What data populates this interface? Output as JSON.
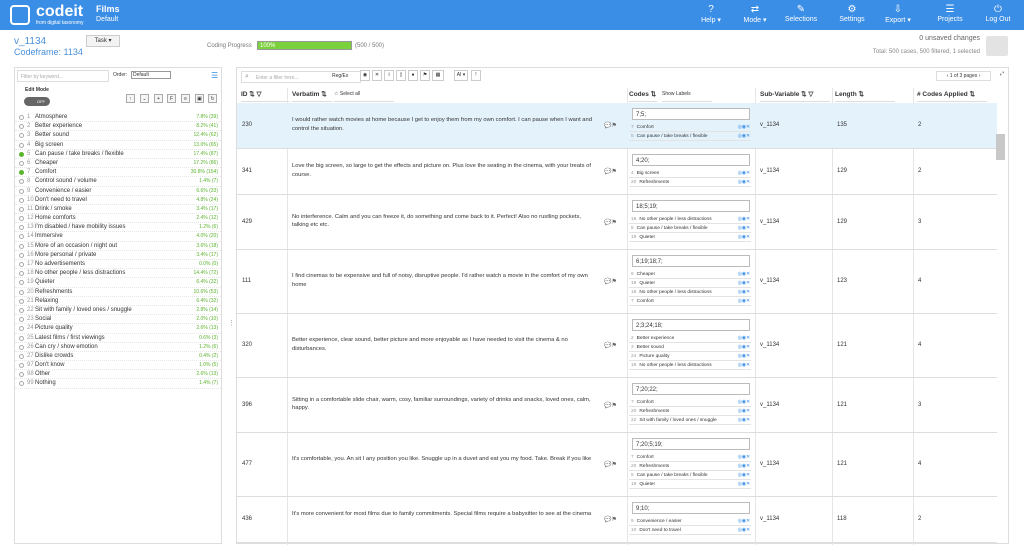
{
  "app": {
    "logo": "codeit",
    "tagline": "from digital taxonomy",
    "project": "Films",
    "project_sub": "Default"
  },
  "nav": [
    {
      "label": "Help ▾",
      "icon": "?"
    },
    {
      "label": "Mode ▾",
      "icon": "⇄"
    },
    {
      "label": "Selections",
      "icon": "✎"
    },
    {
      "label": "Settings",
      "icon": "⚙"
    },
    {
      "label": "Export ▾",
      "icon": "⇩"
    },
    {
      "label": "Projects",
      "icon": "☰"
    },
    {
      "label": "Log Out",
      "icon": "⏻"
    }
  ],
  "header": {
    "variable": "v_1134",
    "codeframe": "Codeframe: 1134",
    "task": "Task ▾",
    "progress_label": "Coding Progress",
    "progress_value": 100,
    "progress_text": "100%",
    "progress_count": "(500 / 500)",
    "unsaved": "0 unsaved changes",
    "total": "Total: 500 cases, 500 filtered, 1 selected"
  },
  "left": {
    "search_placeholder": "Filter by keyword...",
    "order_label": "Order:",
    "order_value": "Default",
    "edit_mode": "Edit Mode",
    "toggle": "OFF",
    "codes": [
      {
        "num": "1",
        "label": "Atmosphere",
        "pct": "7.8% (39)",
        "on": false
      },
      {
        "num": "2",
        "label": "Better experience",
        "pct": "8.2% (41)",
        "on": false
      },
      {
        "num": "3",
        "label": "Better sound",
        "pct": "12.4% (62)",
        "on": false
      },
      {
        "num": "4",
        "label": "Big screen",
        "pct": "13.0% (65)",
        "on": false
      },
      {
        "num": "5",
        "label": "Can pause / take breaks / flexible",
        "pct": "17.4% (87)",
        "on": true
      },
      {
        "num": "6",
        "label": "Cheaper",
        "pct": "17.2% (86)",
        "on": false
      },
      {
        "num": "7",
        "label": "Comfort",
        "pct": "30.8% (154)",
        "on": true
      },
      {
        "num": "8",
        "label": "Control sound / volume",
        "pct": "1.4% (7)",
        "on": false
      },
      {
        "num": "9",
        "label": "Convenience / easier",
        "pct": "6.6% (33)",
        "on": false
      },
      {
        "num": "10",
        "label": "Don't need to travel",
        "pct": "4.8% (24)",
        "on": false
      },
      {
        "num": "11",
        "label": "Drink / smoke",
        "pct": "3.4% (17)",
        "on": false
      },
      {
        "num": "12",
        "label": "Home comforts",
        "pct": "2.4% (12)",
        "on": false
      },
      {
        "num": "13",
        "label": "I'm disabled / have mobility issues",
        "pct": "1.2% (6)",
        "on": false
      },
      {
        "num": "14",
        "label": "Immersive",
        "pct": "4.0% (20)",
        "on": false
      },
      {
        "num": "15",
        "label": "More of an occasion / night out",
        "pct": "3.6% (18)",
        "on": false
      },
      {
        "num": "16",
        "label": "More personal / private",
        "pct": "3.4% (17)",
        "on": false
      },
      {
        "num": "17",
        "label": "No advertisements",
        "pct": "0.0% (0)",
        "on": false
      },
      {
        "num": "18",
        "label": "No other people / less distractions",
        "pct": "14.4% (72)",
        "on": false
      },
      {
        "num": "19",
        "label": "Quieter",
        "pct": "6.4% (32)",
        "on": false
      },
      {
        "num": "20",
        "label": "Refreshments",
        "pct": "10.6% (53)",
        "on": false
      },
      {
        "num": "21",
        "label": "Relaxing",
        "pct": "6.4% (32)",
        "on": false
      },
      {
        "num": "22",
        "label": "Sit with family / loved ones / snuggle",
        "pct": "2.8% (14)",
        "on": false
      },
      {
        "num": "23",
        "label": "Social",
        "pct": "2.0% (10)",
        "on": false
      },
      {
        "num": "24",
        "label": "Picture quality",
        "pct": "2.6% (13)",
        "on": false
      },
      {
        "num": "25",
        "label": "Latest films / first viewings",
        "pct": "0.6% (3)",
        "on": false
      },
      {
        "num": "26",
        "label": "Can cry / show emotion",
        "pct": "1.2% (6)",
        "on": false
      },
      {
        "num": "27",
        "label": "Dislike crowds",
        "pct": "0.4% (2)",
        "on": false
      },
      {
        "num": "97",
        "label": "Don't know",
        "pct": "1.0% (5)",
        "on": false
      },
      {
        "num": "98",
        "label": "Other",
        "pct": "2.6% (13)",
        "on": false
      },
      {
        "num": "99",
        "label": "Nothing",
        "pct": "1.4% (7)",
        "on": false
      }
    ]
  },
  "right": {
    "filter_placeholder": "Enter a filter here...",
    "regex": "Reg/Ex",
    "ai": "AI ▾",
    "pager": "‹ 1 of 3 pages ›",
    "headers": {
      "id": "ID ⇅ ▽",
      "verbatim": "Verbatim ⇅",
      "select_all": "☆ Select all",
      "codes": "Codes ⇅",
      "show_labels": "Show Labels",
      "subvar": "Sub-Variable ⇅ ▽",
      "length": "Length ⇅",
      "ncodes": "# Codes Applied ⇅"
    },
    "rows": [
      {
        "id": "230",
        "verbatim": "I would rather watch movies at home because I get to enjoy them from my own comfort. I can pause when I want and control the situation.",
        "codes": "7;5;",
        "code_lines": [
          {
            "n": "7",
            "l": "Comfort"
          },
          {
            "n": "5",
            "l": "Can pause / take breaks / flexible"
          }
        ],
        "subvar": "v_1134",
        "length": "135",
        "ncodes": "2",
        "sel": true
      },
      {
        "id": "341",
        "verbatim": "Love the big screen, so large to get the effects and picture on. Plus love the seating in the cinema, with your treats of course.",
        "codes": "4;20;",
        "code_lines": [
          {
            "n": "4",
            "l": "Big screen"
          },
          {
            "n": "20",
            "l": "Refreshments"
          }
        ],
        "subvar": "v_1134",
        "length": "129",
        "ncodes": "2",
        "sel": false
      },
      {
        "id": "429",
        "verbatim": "No interference. Calm and you can freeze it, do something and come back to it. Perfect! Also no rustling pockets, talking etc etc.",
        "codes": "18;5;19;",
        "code_lines": [
          {
            "n": "18",
            "l": "No other people / less distractions"
          },
          {
            "n": "5",
            "l": "Can pause / take breaks / flexible"
          },
          {
            "n": "19",
            "l": "Quieter"
          }
        ],
        "subvar": "v_1134",
        "length": "129",
        "ncodes": "3",
        "sel": false
      },
      {
        "id": "111",
        "verbatim": "I find cinemas to be expensive and full of noisy, disruptive people. I'd rather watch a movie in the comfort of my own home",
        "codes": "6;19;18;7;",
        "code_lines": [
          {
            "n": "6",
            "l": "Cheaper"
          },
          {
            "n": "19",
            "l": "Quieter"
          },
          {
            "n": "18",
            "l": "No other people / less distractions"
          },
          {
            "n": "7",
            "l": "Comfort"
          }
        ],
        "subvar": "v_1134",
        "length": "123",
        "ncodes": "4",
        "sel": false
      },
      {
        "id": "320",
        "verbatim": "Better experience, clear sound, better picture and more enjoyable as I have needed to visit the cinema & no disturbances.",
        "codes": "2;3;24;18;",
        "code_lines": [
          {
            "n": "2",
            "l": "Better experience"
          },
          {
            "n": "3",
            "l": "Better sound"
          },
          {
            "n": "24",
            "l": "Picture quality"
          },
          {
            "n": "18",
            "l": "No other people / less distractions"
          }
        ],
        "subvar": "v_1134",
        "length": "121",
        "ncodes": "4",
        "sel": false
      },
      {
        "id": "396",
        "verbatim": "Sitting in a comfortable slide chair, warm, cosy, familiar surroundings, variety of drinks and snacks, loved ones, calm, happy.",
        "codes": "7;20;22;",
        "code_lines": [
          {
            "n": "7",
            "l": "Comfort"
          },
          {
            "n": "20",
            "l": "Refreshments"
          },
          {
            "n": "22",
            "l": "Sit with family / loved ones / snuggle"
          }
        ],
        "subvar": "v_1134",
        "length": "121",
        "ncodes": "3",
        "sel": false
      },
      {
        "id": "477",
        "verbatim": "It's comfortable, you. An sit I any position you like. Snuggle up in a duvet and eat you my food. Take. Break if you like",
        "codes": "7;20;5;19;",
        "code_lines": [
          {
            "n": "7",
            "l": "Comfort"
          },
          {
            "n": "20",
            "l": "Refreshments"
          },
          {
            "n": "5",
            "l": "Can pause / take breaks / flexible"
          },
          {
            "n": "19",
            "l": "Quieter"
          }
        ],
        "subvar": "v_1134",
        "length": "121",
        "ncodes": "4",
        "sel": false
      },
      {
        "id": "436",
        "verbatim": "It's more convenient for most films due to family commitments. Special films require a babysitter to see at the cinema",
        "codes": "9;10;",
        "code_lines": [
          {
            "n": "9",
            "l": "Convenience / easier"
          },
          {
            "n": "10",
            "l": "Don't need to travel"
          }
        ],
        "subvar": "v_1134",
        "length": "118",
        "ncodes": "2",
        "sel": false
      }
    ]
  },
  "colors": {
    "accent": "#3b8ee6",
    "progress": "#7bd13c",
    "selected_row": "#e4f2fc"
  }
}
